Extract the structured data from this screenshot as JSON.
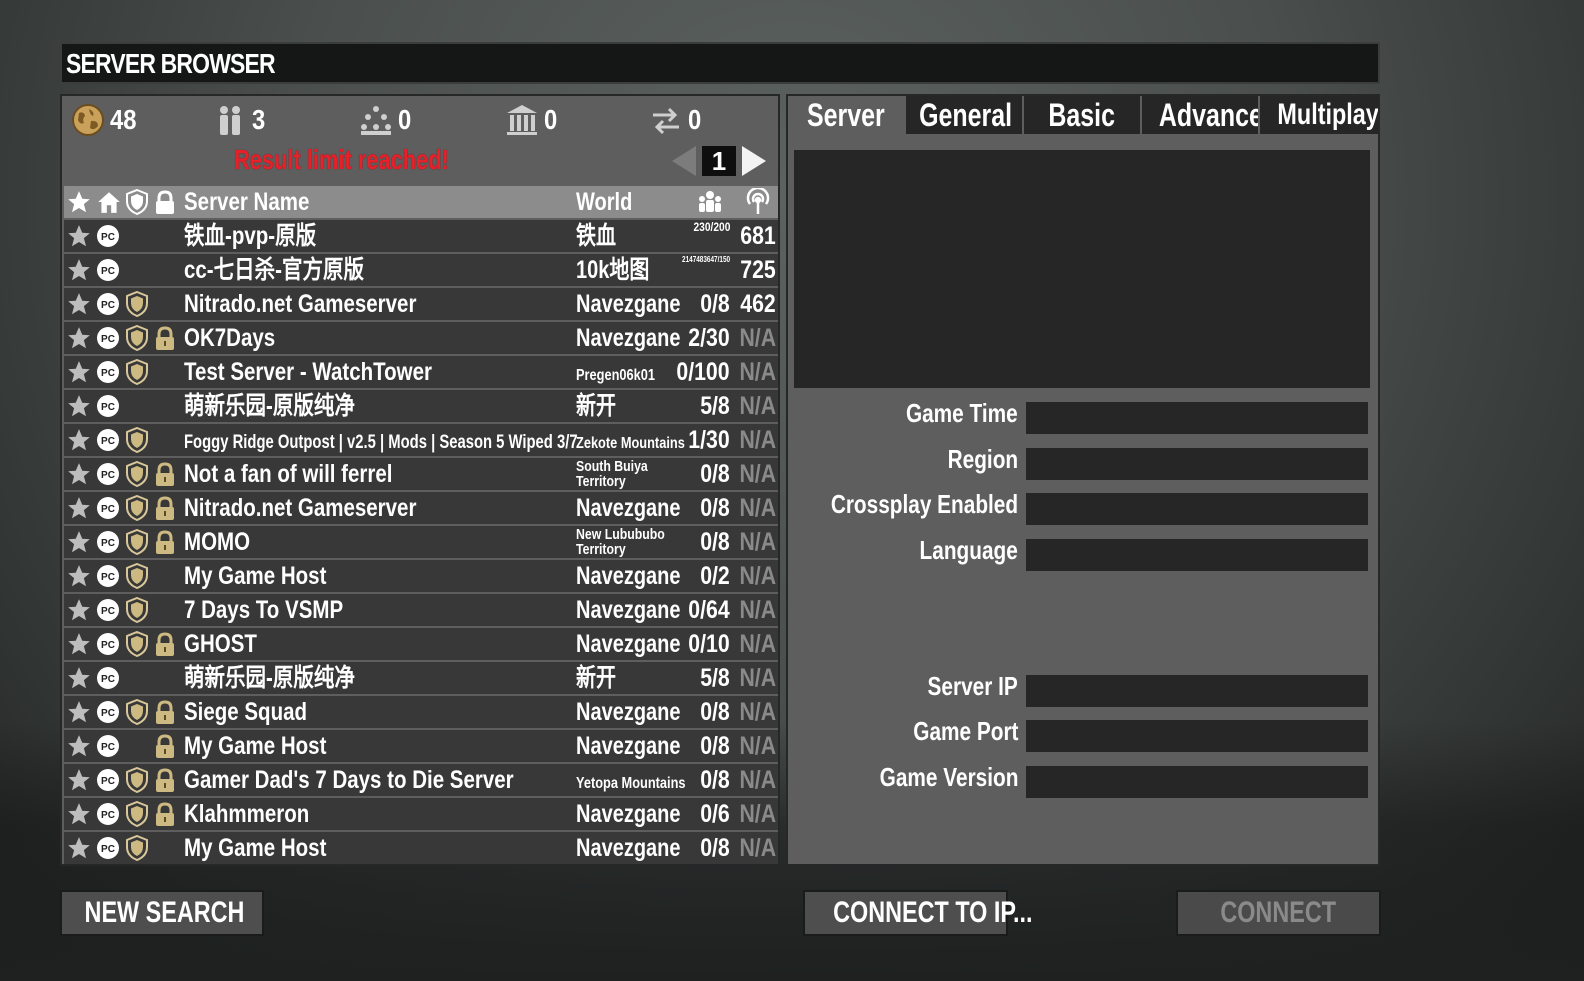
{
  "title": "SERVER BROWSER",
  "stats": {
    "all_servers": "48",
    "friends": "3",
    "lan": "0",
    "history": "0",
    "recent": "0"
  },
  "result_limit_text": "Result limit reached!",
  "page_number": "1",
  "columns": {
    "server_name": "Server Name",
    "world": "World"
  },
  "servers": [
    {
      "name": "铁血-pvp-原版",
      "world": "铁血",
      "players": "230/200",
      "ping": "681",
      "shield": false,
      "lock": false
    },
    {
      "name": "cc-七日杀-官方原版",
      "world": "10k地图",
      "players": "2147483647/150",
      "ping": "725",
      "shield": false,
      "lock": false
    },
    {
      "name": "Nitrado.net Gameserver",
      "world": "Navezgane",
      "players": "0/8",
      "ping": "462",
      "shield": true,
      "lock": false
    },
    {
      "name": "OK7Days",
      "world": "Navezgane",
      "players": "2/30",
      "ping": "N/A",
      "shield": true,
      "lock": true
    },
    {
      "name": "Test Server - WatchTower",
      "world": "Pregen06k01",
      "players": "0/100",
      "ping": "N/A",
      "shield": true,
      "lock": false
    },
    {
      "name": "萌新乐园-原版纯净",
      "world": "新开",
      "players": "5/8",
      "ping": "N/A",
      "shield": false,
      "lock": false
    },
    {
      "name": "Foggy Ridge Outpost | v2.5 | Mods | Season 5 Wiped 3/7",
      "world": "Zekote Mountains",
      "players": "1/30",
      "ping": "N/A",
      "shield": true,
      "lock": false
    },
    {
      "name": "Not a fan of will ferrel",
      "world": "South Buiya Territory",
      "players": "0/8",
      "ping": "N/A",
      "shield": true,
      "lock": true
    },
    {
      "name": "Nitrado.net Gameserver",
      "world": "Navezgane",
      "players": "0/8",
      "ping": "N/A",
      "shield": true,
      "lock": true
    },
    {
      "name": "MOMO",
      "world": "New Lubububo Territory",
      "players": "0/8",
      "ping": "N/A",
      "shield": true,
      "lock": true
    },
    {
      "name": "My Game Host",
      "world": "Navezgane",
      "players": "0/2",
      "ping": "N/A",
      "shield": true,
      "lock": false
    },
    {
      "name": "7 Days To VSMP",
      "world": "Navezgane",
      "players": "0/64",
      "ping": "N/A",
      "shield": true,
      "lock": false
    },
    {
      "name": "GHOST",
      "world": "Navezgane",
      "players": "0/10",
      "ping": "N/A",
      "shield": true,
      "lock": true
    },
    {
      "name": "萌新乐园-原版纯净",
      "world": "新开",
      "players": "5/8",
      "ping": "N/A",
      "shield": false,
      "lock": false
    },
    {
      "name": "Siege Squad",
      "world": "Navezgane",
      "players": "0/8",
      "ping": "N/A",
      "shield": true,
      "lock": true
    },
    {
      "name": "My Game Host",
      "world": "Navezgane",
      "players": "0/8",
      "ping": "N/A",
      "shield": false,
      "lock": true
    },
    {
      "name": "Gamer Dad's 7 Days to Die Server",
      "world": "Yetopa Mountains",
      "players": "0/8",
      "ping": "N/A",
      "shield": true,
      "lock": true
    },
    {
      "name": "Klahmmeron",
      "world": "Navezgane",
      "players": "0/6",
      "ping": "N/A",
      "shield": true,
      "lock": true
    },
    {
      "name": "My Game Host",
      "world": "Navezgane",
      "players": "0/8",
      "ping": "N/A",
      "shield": true,
      "lock": false
    }
  ],
  "tabs": [
    "Server",
    "General",
    "Basic",
    "Advanced",
    "Multiplayer"
  ],
  "info_labels": {
    "game_time": "Game Time",
    "region": "Region",
    "crossplay": "Crossplay Enabled",
    "language": "Language",
    "server_ip": "Server IP",
    "game_port": "Game Port",
    "game_version": "Game Version"
  },
  "buttons": {
    "new_search": "NEW SEARCH",
    "connect_to_ip": "CONNECT TO IP...",
    "connect": "CONNECT"
  },
  "colors": {
    "panel": "#5e5e5e",
    "row": "#383838",
    "header_row": "#8c8c8c",
    "warning": "#e8202a",
    "muted": "#8a8a8a"
  },
  "icons": {
    "row": [
      "star-icon",
      "pc-platform-icon",
      "shield-icon",
      "lock-icon"
    ],
    "stats": [
      "globe-icon",
      "friends-icon",
      "lan-icon",
      "history-icon",
      "recent-icon"
    ]
  }
}
